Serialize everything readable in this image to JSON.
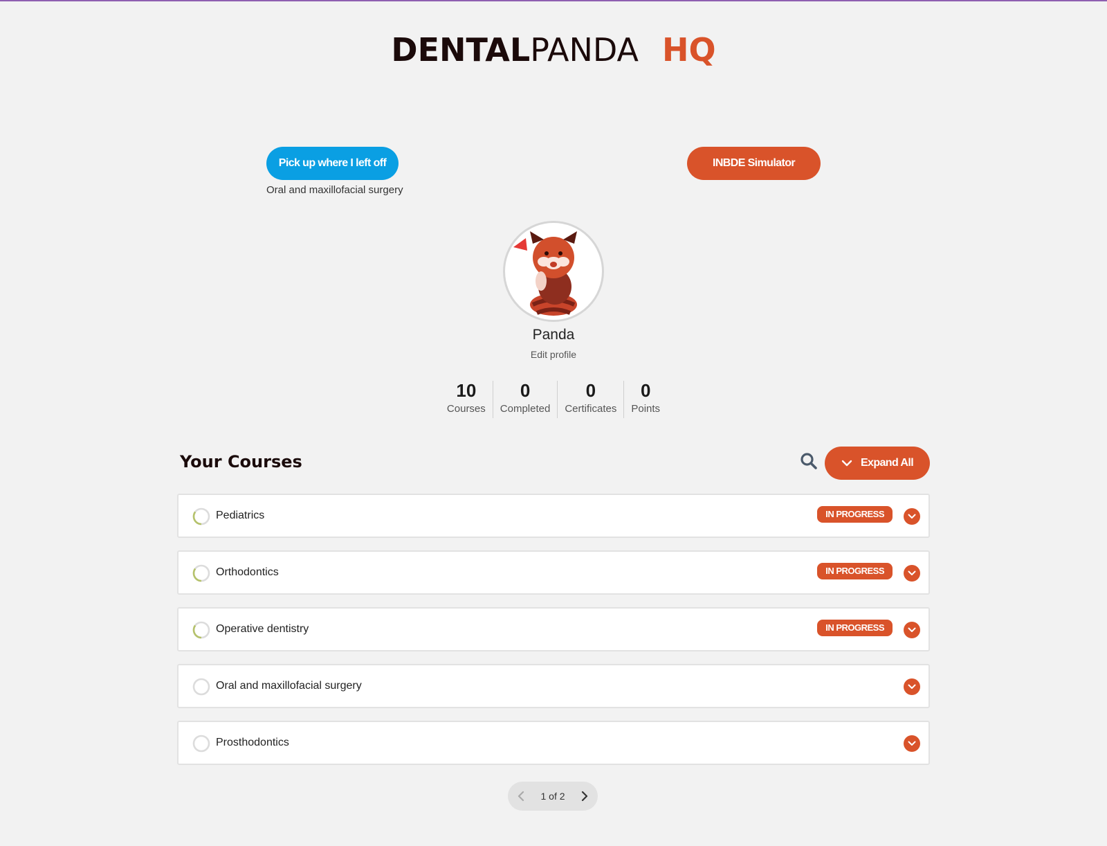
{
  "brand": {
    "part1": "DENTAL",
    "part2": "PANDA",
    "part3": "HQ"
  },
  "actions": {
    "resume_label": "Pick up where I left off",
    "resume_course": "Oral and maxillofacial surgery",
    "simulator_label": "INBDE Simulator"
  },
  "profile": {
    "name": "Panda",
    "edit_label": "Edit profile",
    "avatar_icon": "red-panda-avatar"
  },
  "stats": [
    {
      "value": "10",
      "label": "Courses"
    },
    {
      "value": "0",
      "label": "Completed"
    },
    {
      "value": "0",
      "label": "Certificates"
    },
    {
      "value": "0",
      "label": "Points"
    }
  ],
  "courses_section": {
    "title": "Your Courses",
    "expand_label": "Expand All",
    "search_icon": "search-icon"
  },
  "courses": [
    {
      "name": "Pediatrics",
      "status": "IN PROGRESS",
      "progress": 0.35
    },
    {
      "name": "Orthodontics",
      "status": "IN PROGRESS",
      "progress": 0.35
    },
    {
      "name": "Operative dentistry",
      "status": "IN PROGRESS",
      "progress": 0.35
    },
    {
      "name": "Oral and maxillofacial surgery",
      "status": "",
      "progress": 0
    },
    {
      "name": "Prosthodontics",
      "status": "",
      "progress": 0
    }
  ],
  "pagination": {
    "label": "1 of 2"
  },
  "colors": {
    "accent": "#d9532a",
    "primary": "#0a9fe3",
    "progress_ring": "#b5c26b",
    "ring_track": "#dcdcdc"
  }
}
